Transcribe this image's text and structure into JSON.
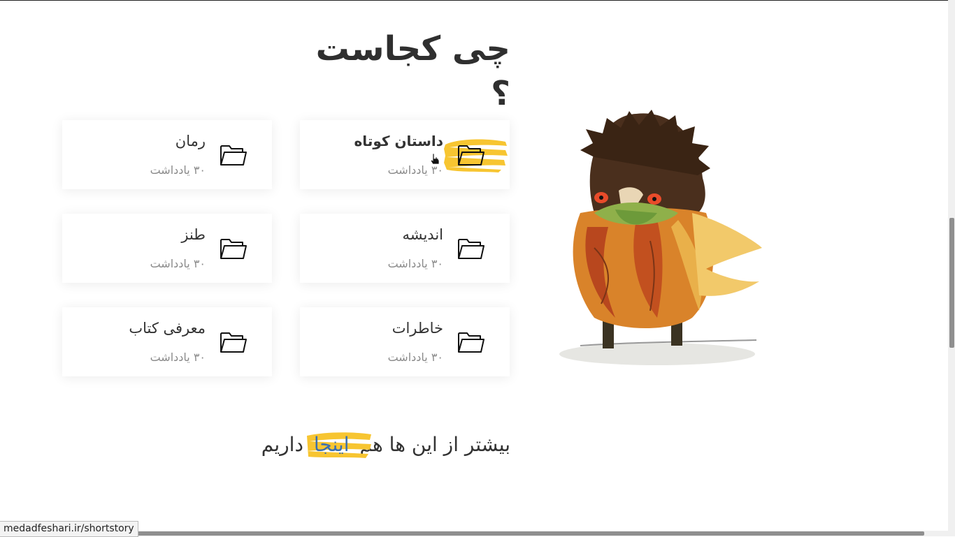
{
  "page": {
    "title": "چی کجاست ؟"
  },
  "categories": [
    {
      "name": "داستان کوتاه",
      "count": "۳۰ یادداشت",
      "icon": "folder-icon",
      "highlighted": true
    },
    {
      "name": "رمان",
      "count": "۳۰ یادداشت",
      "icon": "folder-icon",
      "highlighted": false
    },
    {
      "name": "اندیشه",
      "count": "۳۰ یادداشت",
      "icon": "folder-icon",
      "highlighted": false
    },
    {
      "name": "طنز",
      "count": "۳۰ یادداشت",
      "icon": "folder-icon",
      "highlighted": false
    },
    {
      "name": "خاطرات",
      "count": "۳۰ یادداشت",
      "icon": "folder-icon",
      "highlighted": false
    },
    {
      "name": "معرفی کتاب",
      "count": "۳۰ یادداشت",
      "icon": "folder-icon",
      "highlighted": false
    }
  ],
  "more": {
    "before": "بیشتر از این ها هم ",
    "link": "اینجا",
    "after": " داریم"
  },
  "status": {
    "url": "medadfeshari.ir/shortstory"
  },
  "colors": {
    "accent_brush": "#f7c531",
    "link": "#3a6fb0",
    "text": "#333333",
    "muted": "#8a8a8a"
  }
}
